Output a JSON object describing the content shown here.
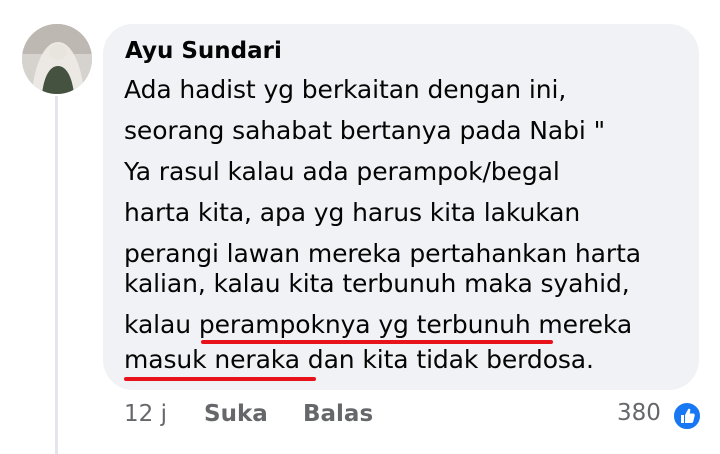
{
  "comment": {
    "author": "Ayu Sundari",
    "lines": [
      "Ada hadist yg berkaitan dengan ini,",
      "seorang sahabat bertanya pada Nabi \"",
      "Ya rasul kalau ada perampok/begal",
      "harta kita, apa yg harus kita lakukan",
      "perangi lawan mereka pertahankan harta",
      "kalian, kalau kita terbunuh maka syahid,",
      "kalau perampoknya yg terbunuh mereka",
      "masuk neraka dan kita tidak berdosa."
    ],
    "highlighted_phrases": [
      "perampoknya yg terbunuh",
      "masuk neraka"
    ],
    "highlight_color": "#e8121b"
  },
  "meta": {
    "time": "12 j",
    "like_label": "Suka",
    "reply_label": "Balas"
  },
  "reactions": {
    "count": "380",
    "icon": "thumbs-up-icon",
    "color": "#1877f2"
  }
}
